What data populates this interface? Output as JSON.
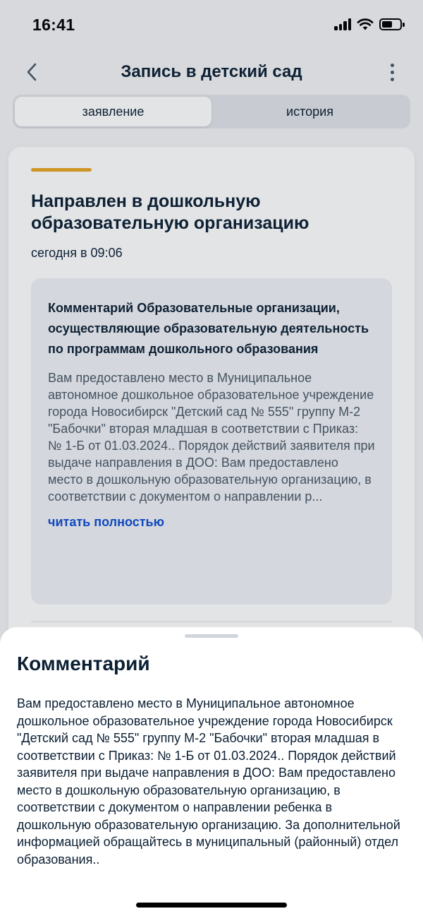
{
  "status_bar": {
    "time": "16:41"
  },
  "header": {
    "title": "Запись в детский сад",
    "back_icon": "chevron-left-icon",
    "menu_icon": "more-vertical-icon"
  },
  "tabs": [
    {
      "label": "заявление",
      "active": true
    },
    {
      "label": "история",
      "active": false
    }
  ],
  "card": {
    "status_title": "Направлен в дошкольную образовательную организацию",
    "date": "сегодня в 09:06",
    "accent_color": "#e8a522",
    "comment": {
      "heading": "Комментарий Образовательные организации, осуществляющие образовательную деятельность по программам дошкольного образования",
      "text": "Вам предоставлено место в Муниципальное автономное дошкольное образовательное учреждение города Новосибирск \"Детский сад № 555\" группу М-2 \"Бабочки\" вторая младшая в соответствии с Приказ: № 1-Б от 01.03.2024.. Порядок действий заявителя при выдаче направления в ДОО: Вам предоставлено место в дошкольную образовательную организацию, в соответствии с документом о направлении р...",
      "read_more": "читать полностью"
    }
  },
  "sheet": {
    "title": "Комментарий",
    "text": "Вам предоставлено место в Муниципальное автономное дошкольное образовательное учреждение города Новосибирск \"Детский сад № 555\" группу М-2 \"Бабочки\" вторая младшая в соответствии с Приказ: № 1-Б от 01.03.2024.. Порядок действий заявителя при выдаче направления в ДОО: Вам предоставлено место в дошкольную образовательную организацию, в соответствии с документом о направлении ребенка в дошкольную образовательную организацию. За дополнительной информацией обращайтесь в муниципальный (районный) отдел образования.."
  },
  "colors": {
    "link": "#0d4cd3",
    "text": "#0b1f33",
    "secondary_text": "#4a5866"
  }
}
